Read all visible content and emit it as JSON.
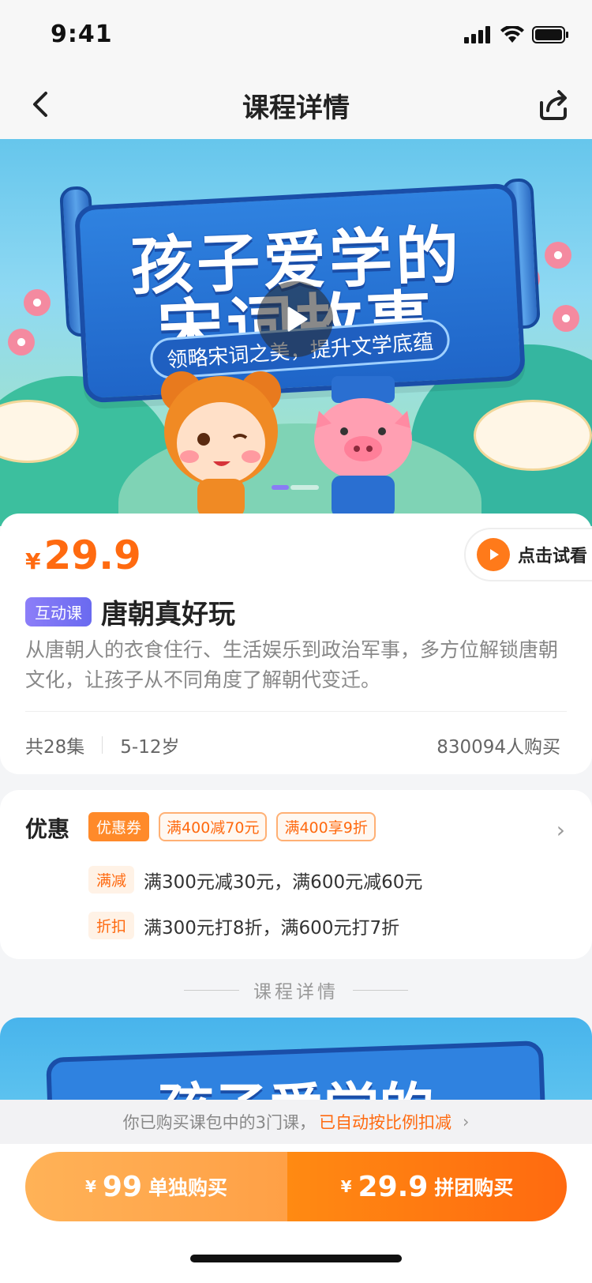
{
  "status_bar": {
    "time": "9:41"
  },
  "nav": {
    "title": "课程详情"
  },
  "banner": {
    "title_line1": "孩子爱学的",
    "title_line2": "宋词故事",
    "subtitle": "领略宋词之美，提升文学底蕴"
  },
  "course": {
    "price_symbol": "¥",
    "price": "29.9",
    "trial_label": "点击试看",
    "tag": "互动课",
    "title": "唐朝真好玩",
    "description": "从唐朝人的衣食住行、生活娱乐到政治军事，多方位解锁唐朝文化，让孩子从不同角度了解朝代变迁。",
    "episodes": "共28集",
    "age_range": "5-12岁",
    "buyers": "830094人购买"
  },
  "promotion": {
    "label": "优惠",
    "coupon_badge": "优惠券",
    "coupons": [
      "满400减70元",
      "满400享9折"
    ],
    "lines": [
      {
        "chip": "满减",
        "text": "满300元减30元，满600元减60元"
      },
      {
        "chip": "折扣",
        "text": "满300元打8折，满600元打7折"
      }
    ]
  },
  "detail_section": {
    "heading": "课程详情",
    "preview_title": "孩子爱学的"
  },
  "notice": {
    "text": "你已购买课包中的3门课，",
    "accent": "已自动按比例扣减"
  },
  "purchase": {
    "single": {
      "symbol": "¥",
      "price": "99",
      "label": "单独购买"
    },
    "group": {
      "symbol": "¥",
      "price": "29.9",
      "label": "拼团购买"
    }
  },
  "colors": {
    "accent": "#ff6a10",
    "tag_purple": "#7c74f4"
  }
}
